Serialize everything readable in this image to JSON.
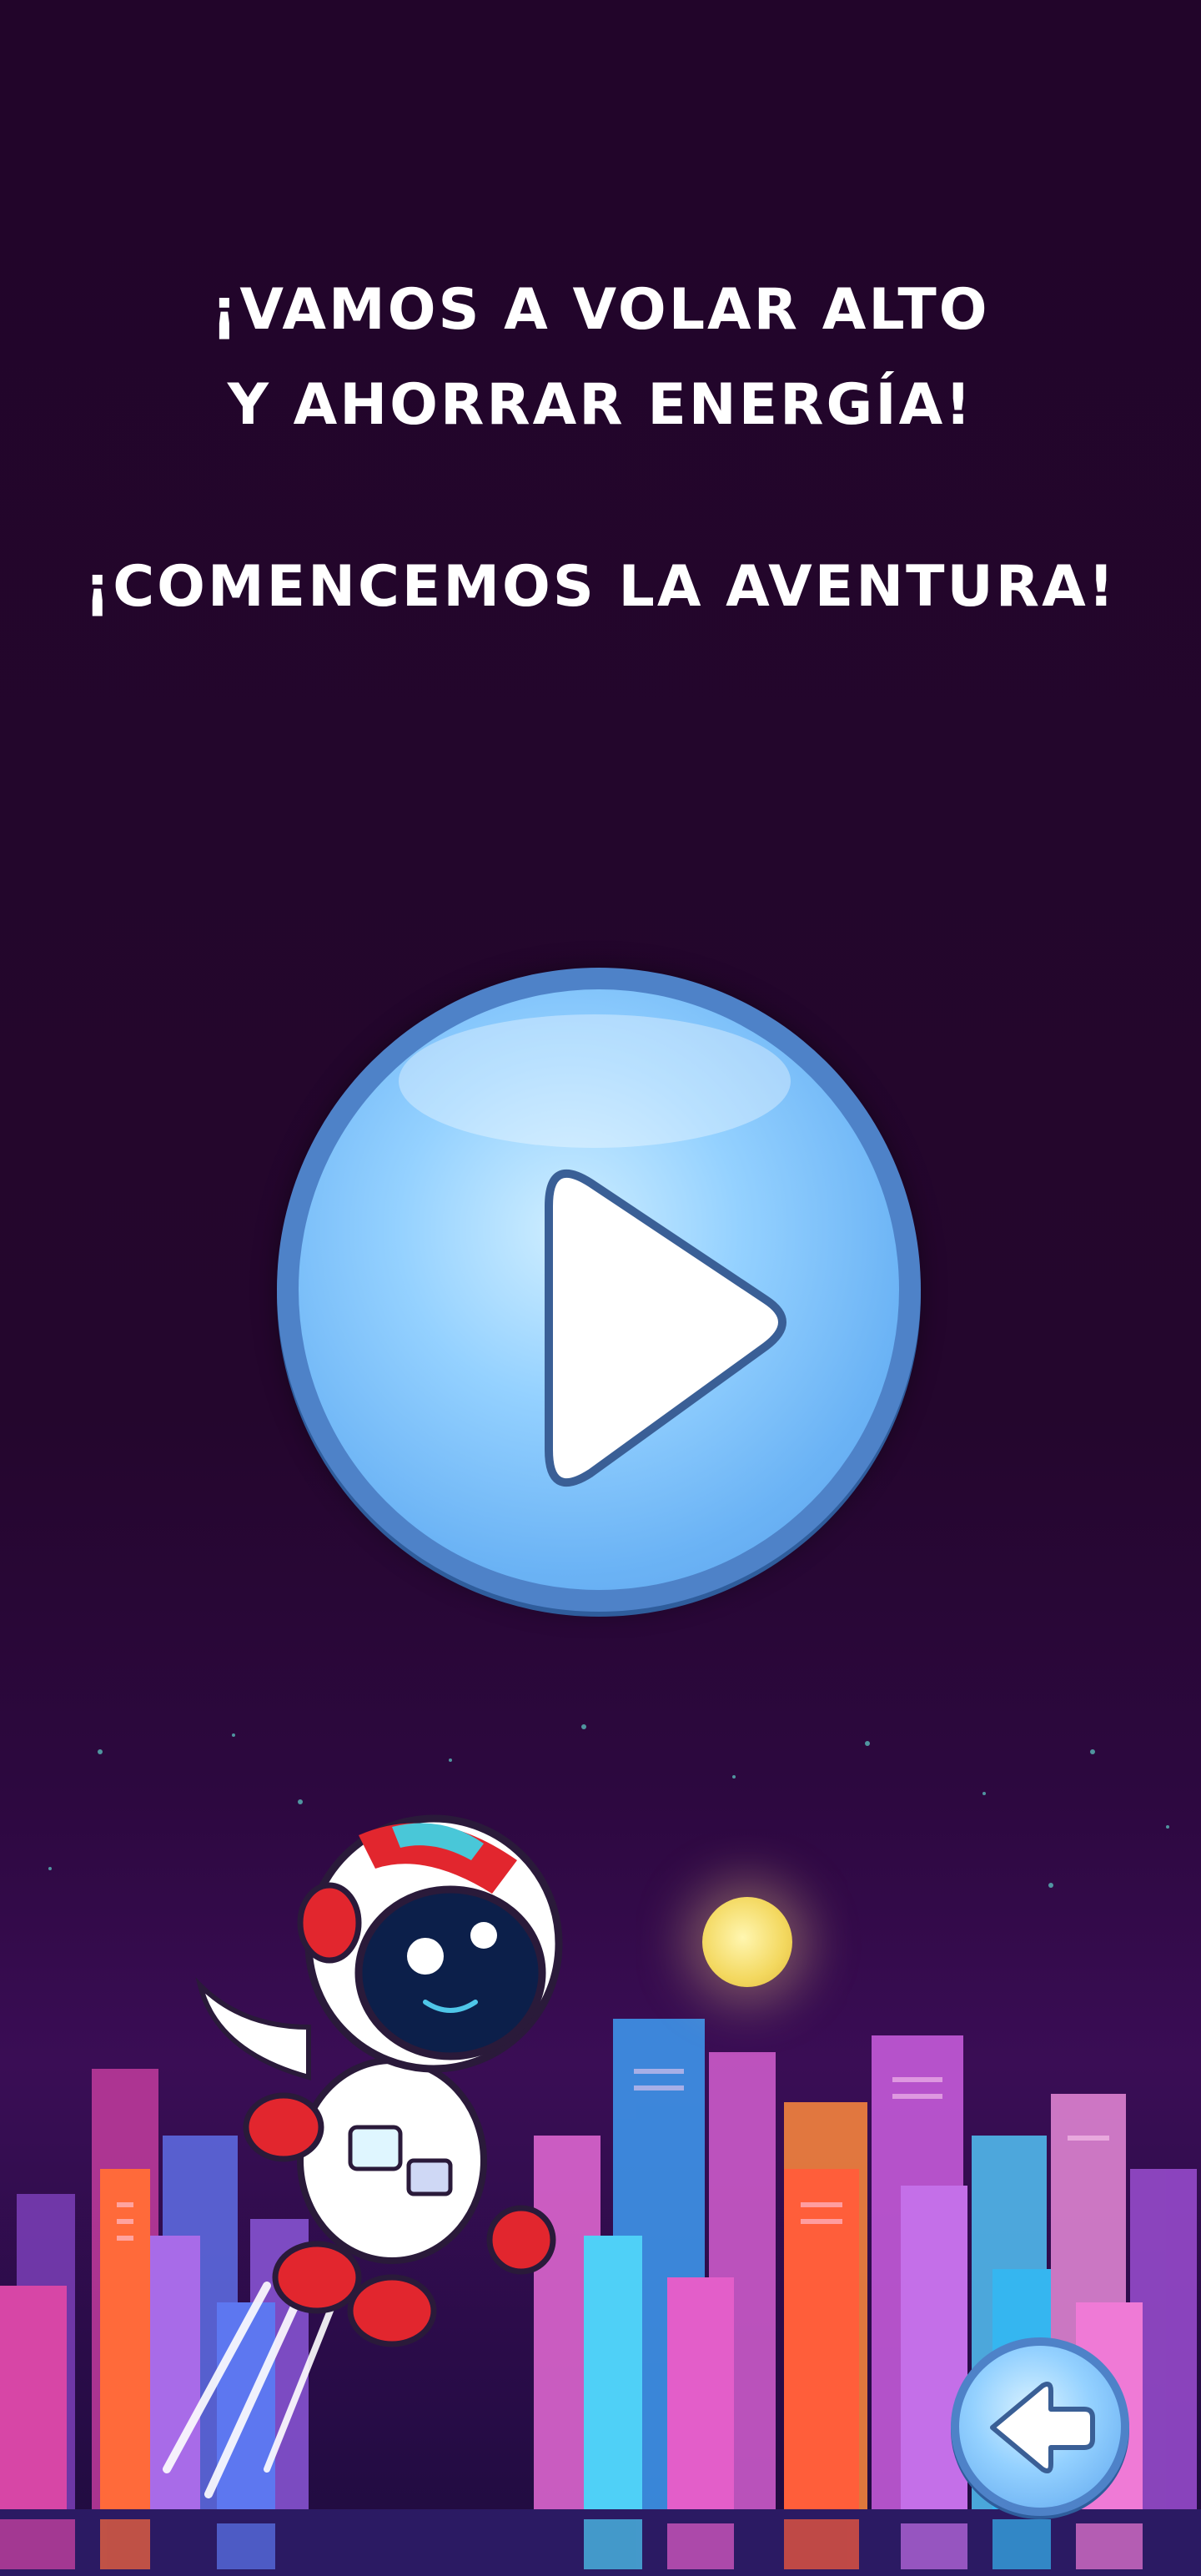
{
  "intro": {
    "line1": "¡VAMOS A VOLAR ALTO",
    "line2": "Y AHORRAR ENERGÍA!",
    "line3": "¡COMENCEMOS LA AVENTURA!"
  },
  "buttons": {
    "play_icon": "play-icon",
    "back_icon": "back-arrow-icon"
  },
  "colors": {
    "background": "#23052b",
    "text": "#ffffff",
    "button_blue": "#6bb3f5",
    "button_border": "#4e82c8"
  }
}
